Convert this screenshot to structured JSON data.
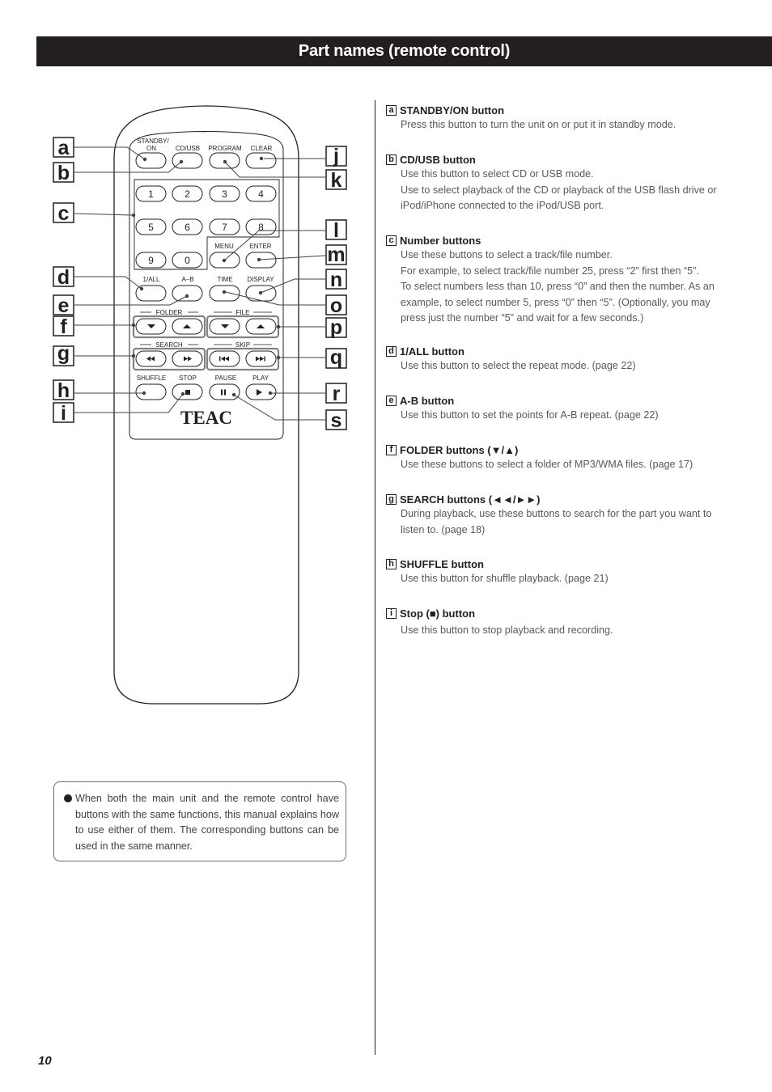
{
  "header": {
    "title": "Part names (remote control)"
  },
  "remote": {
    "brand": "TEAC",
    "button_labels": {
      "standby": "STANDBY/",
      "standby2": "ON",
      "cdusb": "CD/USB",
      "program": "PROGRAM",
      "clear": "CLEAR",
      "menu": "MENU",
      "enter": "ENTER",
      "all": "1/ALL",
      "ab": "A–B",
      "time": "TIME",
      "display": "DISPLAY",
      "folder": "FOLDER",
      "file": "FILE",
      "search": "SEARCH",
      "skip": "SKIP",
      "shuffle": "SHUFFLE",
      "stop": "STOP",
      "pause": "PAUSE",
      "play": "PLAY"
    },
    "numbers": [
      "1",
      "2",
      "3",
      "4",
      "5",
      "6",
      "7",
      "8",
      "9",
      "0"
    ],
    "callouts_left": [
      "a",
      "b",
      "c",
      "d",
      "e",
      "f",
      "g",
      "h",
      "i"
    ],
    "callouts_right": [
      "j",
      "k",
      "l",
      "m",
      "n",
      "o",
      "p",
      "q",
      "r",
      "s"
    ]
  },
  "descriptions": [
    {
      "letter": "a",
      "title": "STANDBY/ON button",
      "lines": [
        "Press this button to turn the unit on or put it in standby mode."
      ]
    },
    {
      "letter": "b",
      "title": "CD/USB button",
      "lines": [
        "Use this button to select CD or USB mode.",
        "Use to select playback of the CD or playback of the USB flash drive or iPod/iPhone connected to the iPod/USB port."
      ]
    },
    {
      "letter": "c",
      "title": "Number buttons",
      "lines": [
        "Use these buttons to select a track/file number.",
        "For example, to select track/file number 25, press “2”  first then “5”.",
        "To select numbers less than 10, press “0” and then the number. As an example, to select number 5, press “0” then “5”. (Optionally, you may press just the number “5” and wait for a few seconds.)"
      ]
    },
    {
      "letter": "d",
      "title": "1/ALL button",
      "lines": [
        "Use this button to select the repeat mode. (page 22)"
      ]
    },
    {
      "letter": "e",
      "title": "A-B button",
      "lines": [
        "Use this button to set the points for A-B repeat. (page 22)"
      ]
    },
    {
      "letter": "f",
      "title": "FOLDER  buttons (▼/▲)",
      "lines": [
        "Use these buttons to select a folder of MP3/WMA files. (page 17)"
      ]
    },
    {
      "letter": "g",
      "title": "SEARCH buttons (◄◄/►►)",
      "lines": [
        "During playback, use these buttons to search for the part you want to listen to. (page 18)"
      ]
    },
    {
      "letter": "h",
      "title": "SHUFFLE button",
      "lines": [
        "Use this button for shuffle playback. (page 21)"
      ]
    },
    {
      "letter": "i",
      "title": "Stop (■) button",
      "lines": [
        "Use this button to stop playback and recording."
      ]
    }
  ],
  "note": {
    "text": "When both the main unit and the remote control have buttons with the same functions, this manual explains how to use either of them. The corresponding buttons can be used in the same manner."
  },
  "footer": {
    "page_number": "10"
  }
}
